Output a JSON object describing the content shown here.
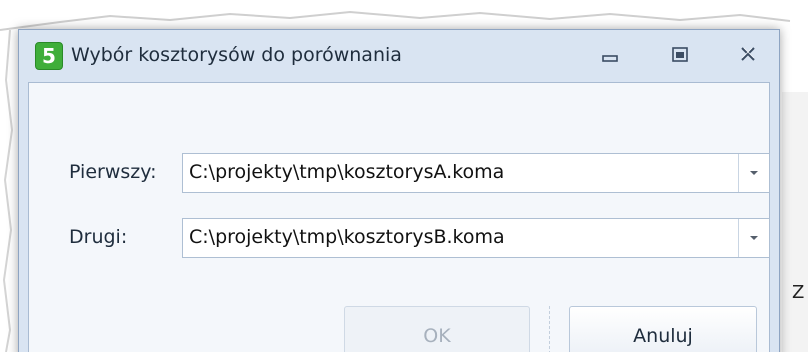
{
  "window": {
    "title": "Wybór kosztorysów do porównania",
    "app_icon_text": "5",
    "accent_color": "#3fae3a",
    "title_buttons": {
      "minimize": "minimize-icon",
      "maximize": "maximize-icon",
      "close": "close-icon"
    }
  },
  "form": {
    "first": {
      "label": "Pierwszy:",
      "value": "C:\\projekty\\tmp\\kosztorysA.koma"
    },
    "second": {
      "label": "Drugi:",
      "value": "C:\\projekty\\tmp\\kosztorysB.koma"
    }
  },
  "buttons": {
    "ok_label": "OK",
    "ok_enabled": false,
    "cancel_label": "Anuluj"
  },
  "background": {
    "partial_letter": "Z"
  }
}
